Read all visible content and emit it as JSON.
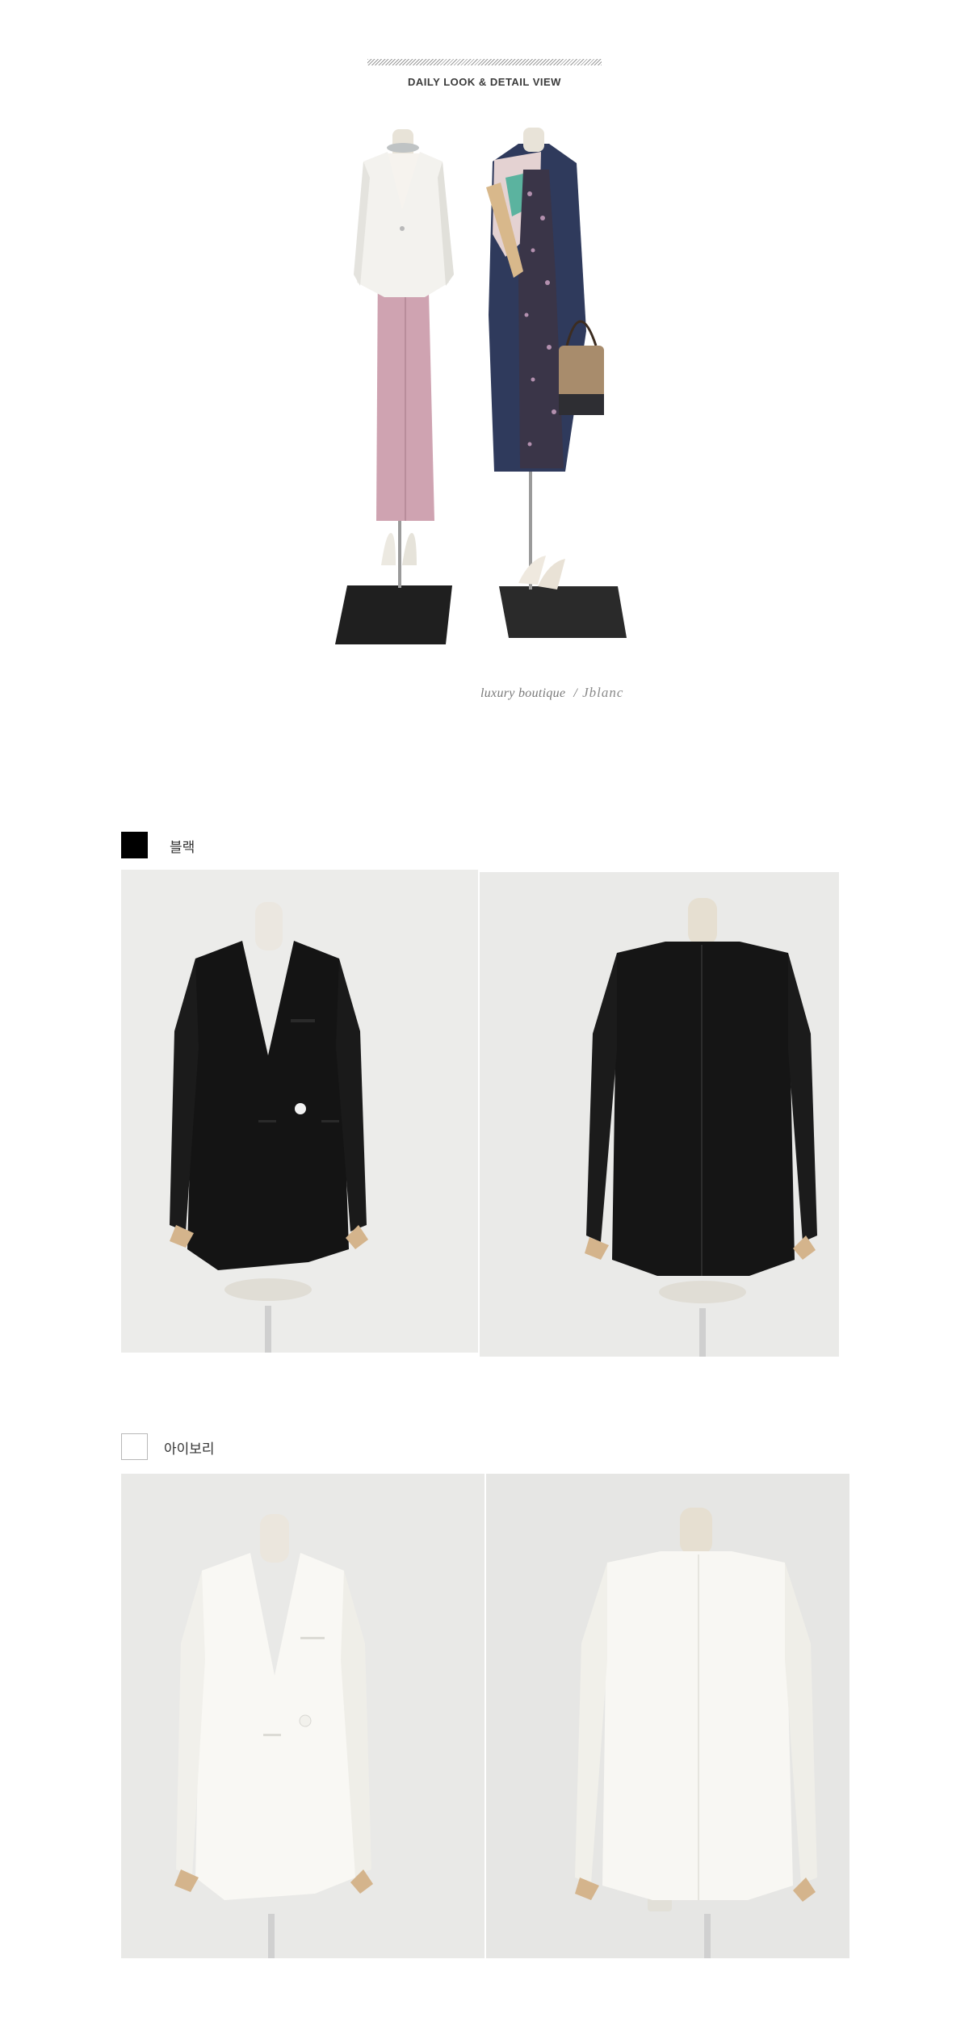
{
  "header": {
    "title": "DAILY LOOK & DETAIL VIEW"
  },
  "brand": {
    "tagline": "luxury boutique",
    "separator": "/",
    "logo": "Jblanc"
  },
  "colors": [
    {
      "name": "블랙",
      "swatch": "#000000"
    },
    {
      "name": "아이보리",
      "swatch": "#ffffff"
    }
  ]
}
